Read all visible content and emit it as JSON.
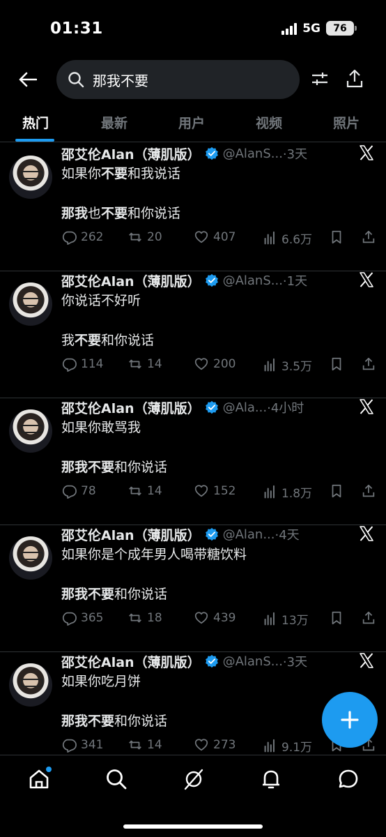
{
  "status": {
    "time": "01:31",
    "network": "5G",
    "battery": "76"
  },
  "search": {
    "query": "那我不要"
  },
  "tabs": [
    {
      "label": "热门",
      "active": true
    },
    {
      "label": "最新",
      "active": false
    },
    {
      "label": "用户",
      "active": false
    },
    {
      "label": "视频",
      "active": false
    },
    {
      "label": "照片",
      "active": false
    }
  ],
  "tweets": [
    {
      "name": "邵艾伦Alan（薄肌版）",
      "handle": "@AlanS...",
      "time": "·3天",
      "line1": [
        {
          "t": "如果你",
          "b": false
        },
        {
          "t": "不要",
          "b": true
        },
        {
          "t": "和我说话",
          "b": false
        }
      ],
      "line2": [
        {
          "t": "那我",
          "b": true
        },
        {
          "t": "也",
          "b": false
        },
        {
          "t": "不要",
          "b": true
        },
        {
          "t": "和你说话",
          "b": false
        }
      ],
      "replies": "262",
      "retweets": "20",
      "likes": "407",
      "views": "6.6万"
    },
    {
      "name": "邵艾伦Alan（薄肌版）",
      "handle": "@AlanS...",
      "time": "·1天",
      "line1": [
        {
          "t": "你说话不好听",
          "b": false
        }
      ],
      "line2": [
        {
          "t": "我",
          "b": false
        },
        {
          "t": "不要",
          "b": true
        },
        {
          "t": "和你说话",
          "b": false
        }
      ],
      "replies": "114",
      "retweets": "14",
      "likes": "200",
      "views": "3.5万"
    },
    {
      "name": "邵艾伦Alan（薄肌版）",
      "handle": "@Ala...",
      "time": "·4小时",
      "line1": [
        {
          "t": "如果你敢骂我",
          "b": false
        }
      ],
      "line2": [
        {
          "t": "那我不要",
          "b": true
        },
        {
          "t": "和你说话",
          "b": false
        }
      ],
      "replies": "78",
      "retweets": "14",
      "likes": "152",
      "views": "1.8万"
    },
    {
      "name": "邵艾伦Alan（薄肌版）",
      "handle": "@Alan...",
      "time": "·4天",
      "line1": [
        {
          "t": "如果你是个成年男人喝带糖饮料",
          "b": false
        }
      ],
      "line2": [
        {
          "t": "那我不要",
          "b": true
        },
        {
          "t": "和你说话",
          "b": false
        }
      ],
      "replies": "365",
      "retweets": "18",
      "likes": "439",
      "views": "13万"
    },
    {
      "name": "邵艾伦Alan（薄肌版）",
      "handle": "@AlanS...",
      "time": "·3天",
      "line1": [
        {
          "t": "如果你吃月饼",
          "b": false
        }
      ],
      "line2": [
        {
          "t": "那我不要",
          "b": true
        },
        {
          "t": "和你说话",
          "b": false
        }
      ],
      "replies": "341",
      "retweets": "14",
      "likes": "273",
      "views": "9.1万"
    }
  ],
  "colors": {
    "accent": "#1d9bf0",
    "muted": "#71767b",
    "background": "#000000"
  }
}
